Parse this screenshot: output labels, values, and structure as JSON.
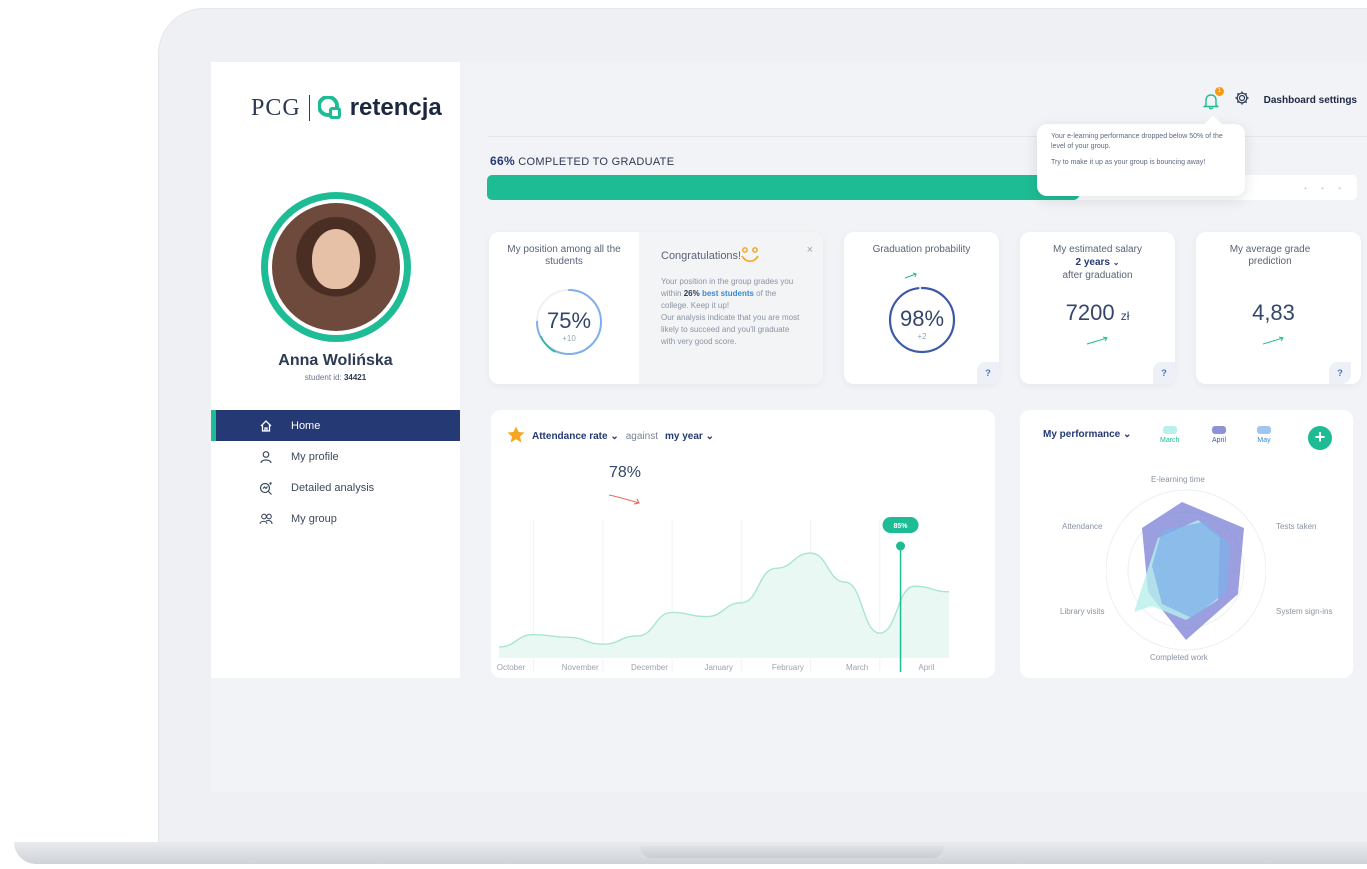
{
  "logo": {
    "pcg": "PCG",
    "name": "retencja"
  },
  "user": {
    "name": "Anna Wolińska",
    "id_label": "student id:",
    "id_value": "34421"
  },
  "nav": [
    {
      "label": "Home",
      "icon": "home-icon",
      "active": true
    },
    {
      "label": "My profile",
      "icon": "user-icon"
    },
    {
      "label": "Detailed analysis",
      "icon": "analysis-icon"
    },
    {
      "label": "My group",
      "icon": "group-icon"
    }
  ],
  "header": {
    "notification_count": "1",
    "settings_label": "Dashboard settings"
  },
  "tooltip": {
    "line1": "Your e-learning performance dropped below 50% of the level of your group.",
    "line2": "Try to make it up as your group is bouncing away!"
  },
  "progress": {
    "percent_label": "66%",
    "text": "COMPLETED TO GRADUATE",
    "value": 0.68,
    "dots": "• • •"
  },
  "cards": {
    "position": {
      "title": "My position among all the students",
      "value": "75%",
      "delta": "+10",
      "fraction": 0.75
    },
    "congrats": {
      "title": "Congratulations!",
      "text_a": "Your position in the group grades you within ",
      "text_b": "26%",
      "text_c": "best students",
      "text_d": " of the college. Keep it up!",
      "text_e": "Our analysis indicate that you are most likely to succeed and you'll graduate with very good score.",
      "close": "×"
    },
    "graduation": {
      "title": "Graduation probability",
      "value": "98%",
      "delta": "+2",
      "fraction": 0.98,
      "help": "?"
    },
    "salary": {
      "title": "My estimated salary",
      "period": "2 years",
      "after": "after graduation",
      "value": "7200",
      "unit": "zł",
      "help": "?"
    },
    "grade": {
      "title": "My average grade prediction",
      "value": "4,83",
      "help": "?"
    }
  },
  "attendance": {
    "title": "Attendance rate",
    "against": "against",
    "group": "my year",
    "value": "78%",
    "marker_label": "85%"
  },
  "chart_data": {
    "type": "area",
    "categories": [
      "October",
      "November",
      "December",
      "January",
      "February",
      "March",
      "April"
    ],
    "x": [
      0,
      0.5,
      1,
      1.5,
      2,
      2.5,
      3,
      3.5,
      4,
      4.5,
      5,
      5.5,
      6,
      6.5
    ],
    "values": [
      8,
      17,
      15,
      10,
      16,
      33,
      30,
      40,
      65,
      76,
      55,
      18,
      52,
      48
    ],
    "title": "Attendance rate",
    "xlabel": "",
    "ylabel": "",
    "ylim": [
      0,
      100
    ],
    "marker": {
      "x": 5.8,
      "label": "85%"
    }
  },
  "performance": {
    "title": "My performance",
    "legend": [
      {
        "name": "March",
        "color": "#7ee6e0"
      },
      {
        "name": "April",
        "color": "#6e74c9"
      },
      {
        "name": "May",
        "color": "#7fb0ea"
      }
    ],
    "add": "+",
    "axes": [
      "E-learning time",
      "Tests taken",
      "System sign-ins",
      "Completed work",
      "Library visits",
      "Attendance"
    ]
  },
  "colors": {
    "accent": "#1ebc94",
    "navy": "#253a74",
    "blue": "#3a88d6"
  }
}
